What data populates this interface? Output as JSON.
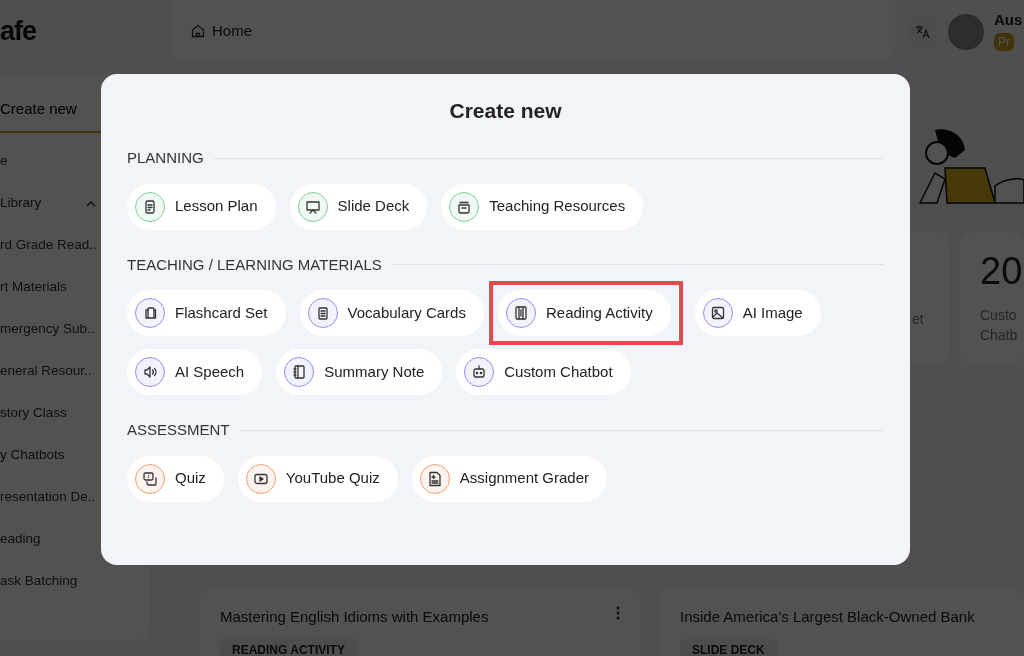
{
  "app": {
    "logo": "afe",
    "create_button": "Create new",
    "sidebar_items": [
      {
        "label": "e",
        "kind": "link"
      },
      {
        "label": "Library",
        "kind": "group"
      },
      {
        "label": "rd Grade Read..",
        "kind": "link"
      },
      {
        "label": "rt Materials",
        "kind": "link"
      },
      {
        "label": "mergency Sub..",
        "kind": "link"
      },
      {
        "label": "eneral Resour..",
        "kind": "link"
      },
      {
        "label": "story Class",
        "kind": "link"
      },
      {
        "label": "y Chatbots",
        "kind": "link"
      },
      {
        "label": "resentation De..",
        "kind": "link"
      },
      {
        "label": "eading",
        "kind": "link"
      },
      {
        "label": "ask Batching",
        "kind": "link"
      }
    ],
    "breadcrumb": "Home",
    "user": {
      "name": "Aus",
      "badge": "Pr"
    },
    "stat_cards": [
      {
        "lines": [
          "et"
        ]
      },
      {
        "value": "20",
        "lines": [
          "Custo",
          "Chatb"
        ]
      }
    ],
    "recent_cards": [
      {
        "title": "Mastering English Idioms with Examples",
        "tag": "READING ACTIVITY",
        "has_menu": true
      },
      {
        "title": "Inside America's Largest Black-Owned Bank",
        "tag": "SLIDE DECK",
        "has_menu": false
      }
    ]
  },
  "modal": {
    "title": "Create new",
    "sections": [
      {
        "heading": "PLANNING",
        "color": "#7fcf95",
        "items": [
          {
            "label": "Lesson Plan",
            "highlighted": false
          },
          {
            "label": "Slide Deck",
            "highlighted": false
          },
          {
            "label": "Teaching Resources",
            "highlighted": false
          }
        ]
      },
      {
        "heading": "TEACHING / LEARNING MATERIALS",
        "color": "#9090f0",
        "items": [
          {
            "label": "Flashcard Set",
            "highlighted": false
          },
          {
            "label": "Vocabulary Cards",
            "highlighted": false
          },
          {
            "label": "Reading Activity",
            "highlighted": true
          },
          {
            "label": "AI Image",
            "highlighted": false
          },
          {
            "label": "AI Speech",
            "highlighted": false
          },
          {
            "label": "Summary Note",
            "highlighted": false
          },
          {
            "label": "Custom Chatbot",
            "highlighted": false
          }
        ]
      },
      {
        "heading": "ASSESSMENT",
        "color": "#f0a070",
        "items": [
          {
            "label": "Quiz",
            "highlighted": false
          },
          {
            "label": "YouTube Quiz",
            "highlighted": false
          },
          {
            "label": "Assignment Grader",
            "highlighted": false
          }
        ]
      }
    ]
  }
}
